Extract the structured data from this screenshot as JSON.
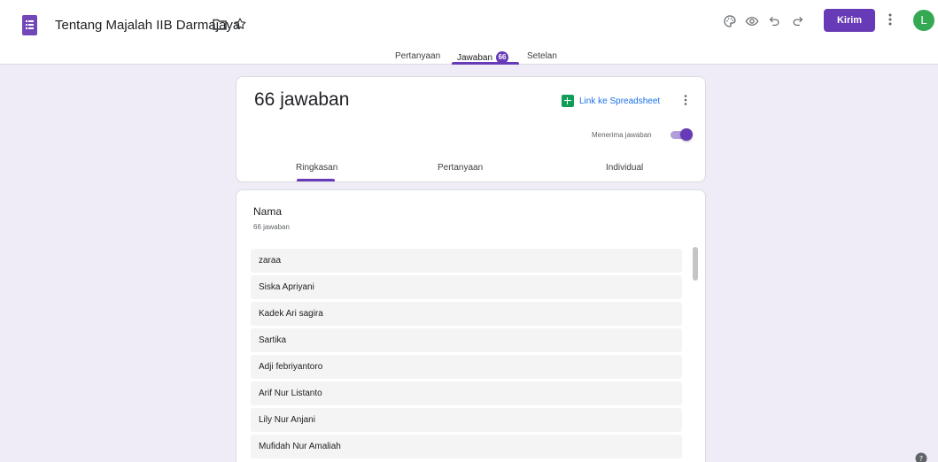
{
  "header": {
    "title": "Tentang Majalah IIB Darmajaya",
    "send_label": "Kirim",
    "avatar_initial": "L",
    "icons": [
      "palette-icon",
      "preview-eye-icon",
      "undo-icon",
      "redo-icon",
      "more-vert-icon",
      "folder-icon",
      "star-icon"
    ]
  },
  "tabs": {
    "questions": "Pertanyaan",
    "responses": "Jawaban",
    "responses_badge": "66",
    "settings": "Setelan"
  },
  "summary_card": {
    "count_title": "66 jawaban",
    "spreadsheet_link": "Link ke Spreadsheet",
    "accepting_label": "Menerima jawaban",
    "accepting": true,
    "subtabs": {
      "summary": "Ringkasan",
      "question": "Pertanyaan",
      "individual": "Individual"
    }
  },
  "question_card": {
    "title": "Nama",
    "count": "66 jawaban",
    "answers": [
      "zaraa",
      "Siska Apriyani",
      "Kadek Ari sagira",
      "Sartika",
      "Adji febriyantoro",
      "Arif Nur Listanto",
      "Lily Nur Anjani",
      "Mufidah Nur Amaliah"
    ]
  },
  "colors": {
    "accent": "#673ab7",
    "background": "#efebf7",
    "sheet_green": "#0f9d58",
    "avatar_green": "#34a853",
    "link_blue": "#1a73e8"
  }
}
